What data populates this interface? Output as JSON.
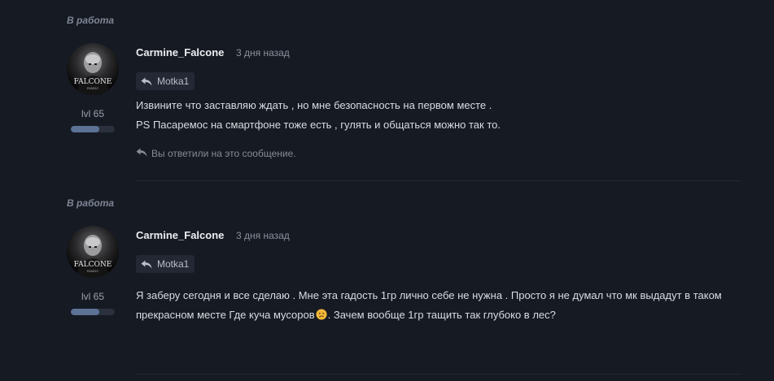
{
  "posts": [
    {
      "status": "В работа",
      "author": "Carmine_Falcone",
      "time": "3 дня назад",
      "level": "lvl 65",
      "level_progress": 0.65,
      "avatar_text": "FALCONE",
      "avatar_subtext": "FAMILY",
      "reply_to": "Motka1",
      "message_lines": [
        "Извините что заставляю ждать , но мне безопасность на первом месте .",
        "PS Пасаремос на смартфоне тоже есть , гулять и общаться можно так то."
      ],
      "replied_note": "Вы ответили на это сообщение."
    },
    {
      "status": "В работа",
      "author": "Carmine_Falcone",
      "time": "3 дня назад",
      "level": "lvl 65",
      "level_progress": 0.65,
      "avatar_text": "FALCONE",
      "avatar_subtext": "FAMILY",
      "reply_to": "Motka1",
      "message_part1": "Я заберу сегодня и все сделаю . Мне эта гадость 1гр лично себе не нужна . Просто я не думал что мк выдадут в таком прекрасном месте Где куча мусоров",
      "message_part2": ". Зачем вообще 1гр тащить так глубоко в лес?"
    }
  ],
  "icons": {
    "reply": "reply-arrow-icon",
    "emoji": "confused-face-icon"
  },
  "colors": {
    "background": "#161a23",
    "level_bar_fill": "#5c7395",
    "quote_background": "#232834"
  }
}
